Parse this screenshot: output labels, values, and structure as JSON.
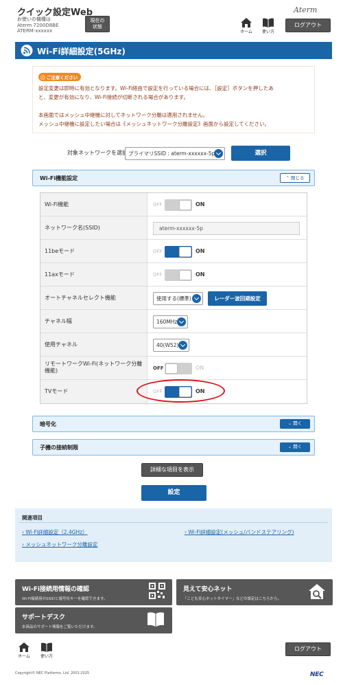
{
  "header": {
    "title": "クイック設定Web",
    "device_line1": "お使いの機種は",
    "device_line2": "Aterm 7200D8BE",
    "device_line3": "ATERM-xxxxxx",
    "status_button_line1": "現在の",
    "status_button_line2": "状態",
    "brand": "Aterm",
    "home_label": "ホーム",
    "help_label": "使い方",
    "logout_label": "ログアウト"
  },
  "page": {
    "title": "Wi-Fi詳細設定(5GHz)"
  },
  "notice": {
    "badge": "ご注意ください",
    "line1": "設定変更は即時に有効となります。Wi-Fi経由で設定を行っている場合には、［設定］ボタンを押したあ",
    "line2": "と、変更が有効になり、Wi-Fi接続が切断される場合があります。",
    "line3": "本画面ではメッシュ中継機に対してネットワーク分離は適用されません。",
    "line4": "メッシュ中継機に設定したい場合は《メッシュネットワーク分離設定》画面から設定してください。"
  },
  "network_select": {
    "label": "対象ネットワークを選択",
    "selected": "プライマリSSID : aterm-xxxxxx-5p",
    "button": "選択"
  },
  "wifi_section": {
    "title": "Wi-Fi機能設定",
    "toggle_label": "閉じる",
    "rows": [
      {
        "label": "Wi-Fi機能",
        "off": "OFF",
        "on": "ON",
        "state": "on",
        "enabled": false
      },
      {
        "label": "ネットワーク名(SSID)",
        "value": "aterm-xxxxxx-5p"
      },
      {
        "label": "11beモード",
        "off": "OFF",
        "on": "ON",
        "state": "on",
        "enabled": true
      },
      {
        "label": "11axモード",
        "off": "OFF",
        "on": "ON",
        "state": "on",
        "enabled": false
      },
      {
        "label": "オートチャネルセレクト機能",
        "value": "使用する(標準)",
        "button": "レーダー波回避設定"
      },
      {
        "label": "チャネル幅",
        "value": "160MHz"
      },
      {
        "label": "使用チャネル",
        "value": "40(W52)"
      },
      {
        "label_line1": "リモートワークWi-Fi(ネットワーク分離",
        "label_line2": "機能)",
        "off": "OFF",
        "on": "ON",
        "state": "off",
        "enabled": false
      },
      {
        "label": "TVモード",
        "off": "OFF",
        "on": "ON",
        "state": "on",
        "enabled": true
      }
    ]
  },
  "encryption_section": {
    "title": "暗号化",
    "toggle_label": "開く"
  },
  "client_section": {
    "title": "子機の接続制限",
    "toggle_label": "開く"
  },
  "actions": {
    "show_details": "詳細な項目を表示",
    "apply": "設定"
  },
  "related": {
    "title": "関連項目",
    "links": [
      "Wi-Fi詳細設定（2.4GHz）",
      "Wi-Fi詳細設定(メッシュ/バンドステアリング)",
      "メッシュネットワーク分離設定"
    ]
  },
  "tiles": [
    {
      "title": "Wi-Fi接続用情報の確認",
      "desc": "Wi-Fi接続用のSSIDと暗号化キーを確認できます。",
      "icon": "qr-code-icon"
    },
    {
      "title": "見えて安心ネット",
      "desc": "「こども安心ネットタイマー」などの設定はこちらから。",
      "icon": "home-search-icon"
    },
    {
      "title": "サポートデスク",
      "desc": "本商品のサポート情報をご覧いただけます。",
      "icon": "book-icon"
    }
  ],
  "footer": {
    "copyright": "Copyright© NEC Platforms, Ltd. 2001-2025",
    "maker": "NEC"
  },
  "colors": {
    "accent": "#1a64a8",
    "highlight": "#e0101a",
    "notice_text": "#8a3a1a"
  }
}
